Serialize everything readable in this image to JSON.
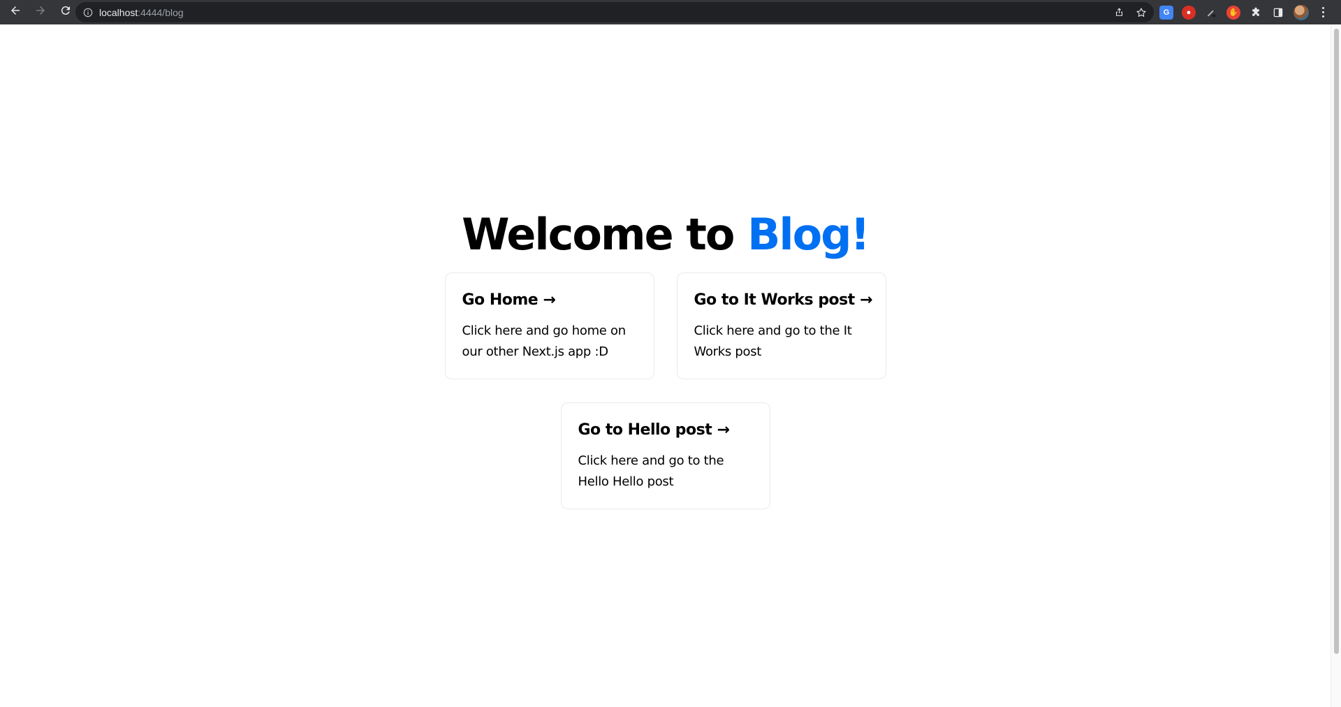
{
  "browser": {
    "url_host": "localhost",
    "url_rest": ":4444/blog",
    "icons": {
      "back": "arrow-left-icon",
      "forward": "arrow-right-icon",
      "reload": "reload-icon",
      "info": "info-icon",
      "share": "share-icon",
      "bookmark": "star-icon",
      "extensions": "puzzle-icon",
      "sidepanel": "side-panel-icon",
      "menu": "kebab-menu-icon"
    }
  },
  "page": {
    "title_prefix": "Welcome to ",
    "title_accent": "Blog!",
    "accent_color": "#0070f3",
    "cards": [
      {
        "title": "Go Home →",
        "description": "Click here and go home on our other Next.js app :D"
      },
      {
        "title": "Go to It Works post →",
        "description": "Click here and go to the It Works post"
      },
      {
        "title": "Go to Hello post →",
        "description": "Click here and go to the Hello Hello post"
      }
    ]
  }
}
